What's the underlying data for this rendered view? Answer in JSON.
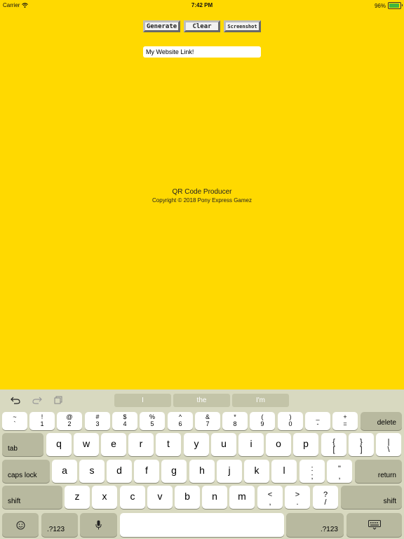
{
  "status_bar": {
    "carrier": "Carrier",
    "time": "7:42 PM",
    "battery": "96%",
    "battery_level": 0.96
  },
  "toolbar": {
    "generate_label": "Generate",
    "clear_label": "Clear",
    "screenshot_label": "Screenshot"
  },
  "link_input": {
    "value": "My Website Link!"
  },
  "footer": {
    "title": "QR Code Producer",
    "copyright": "Copyright © 2018 Pony Express Gamez"
  },
  "keyboard": {
    "suggestions": [
      "I",
      "the",
      "I'm"
    ],
    "number_row": [
      {
        "top": "~",
        "bottom": "`"
      },
      {
        "top": "!",
        "bottom": "1"
      },
      {
        "top": "@",
        "bottom": "2"
      },
      {
        "top": "#",
        "bottom": "3"
      },
      {
        "top": "$",
        "bottom": "4"
      },
      {
        "top": "%",
        "bottom": "5"
      },
      {
        "top": "^",
        "bottom": "6"
      },
      {
        "top": "&",
        "bottom": "7"
      },
      {
        "top": "*",
        "bottom": "8"
      },
      {
        "top": "(",
        "bottom": "9"
      },
      {
        "top": ")",
        "bottom": "0"
      },
      {
        "top": "_",
        "bottom": "-"
      },
      {
        "top": "+",
        "bottom": "="
      }
    ],
    "delete_label": "delete",
    "tab_label": "tab",
    "row_q": [
      "q",
      "w",
      "e",
      "r",
      "t",
      "y",
      "u",
      "i",
      "o",
      "p"
    ],
    "row_q_symbols": [
      {
        "top": "{",
        "bottom": "["
      },
      {
        "top": "}",
        "bottom": "]"
      },
      {
        "top": "|",
        "bottom": "\\"
      }
    ],
    "caps_label": "caps lock",
    "row_a": [
      "a",
      "s",
      "d",
      "f",
      "g",
      "h",
      "j",
      "k",
      "l"
    ],
    "row_a_symbols": [
      {
        "top": ":",
        "bottom": ";"
      },
      {
        "top": "\"",
        "bottom": ","
      }
    ],
    "return_label": "return",
    "shift_label": "shift",
    "row_z": [
      "z",
      "x",
      "c",
      "v",
      "b",
      "n",
      "m"
    ],
    "row_z_symbols": [
      {
        "top": "<",
        "bottom": ","
      },
      {
        "top": ">",
        "bottom": "."
      },
      {
        "top": "?",
        "bottom": "/"
      }
    ],
    "numbers_label": ".?123"
  }
}
